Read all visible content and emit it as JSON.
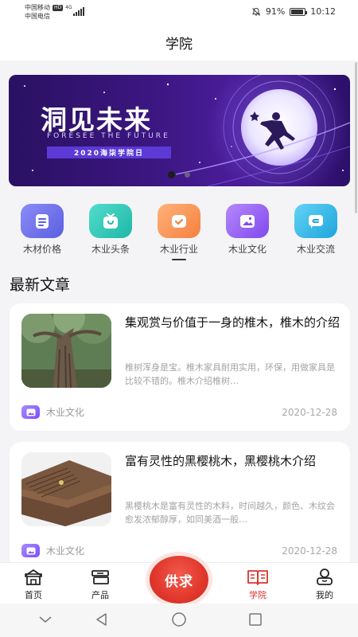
{
  "status_bar": {
    "carrier1": "中国移动",
    "carrier1_badge": "HD",
    "network": "4G",
    "carrier2": "中国电信",
    "battery_percent": "91%",
    "battery_level": 0.91,
    "time": "10:12"
  },
  "header": {
    "title": "学院"
  },
  "banner": {
    "title": "洞见未来",
    "subtitle": "FORESEE THE FUTURE",
    "tag": "2020海柒学院日",
    "colors": {
      "bg_start": "#2a1162",
      "bg_end": "#4a1c98"
    },
    "slides": 2,
    "active_slide": 1
  },
  "categories": [
    {
      "label": "木材价格",
      "icon": "document-icon",
      "color": "#6b6fe8"
    },
    {
      "label": "木业头条",
      "icon": "headline-box-icon",
      "color": "#2cc8b8"
    },
    {
      "label": "木业行业",
      "icon": "check-badge-icon",
      "color": "#f8935a"
    },
    {
      "label": "木业文化",
      "icon": "picture-icon",
      "color": "#9a63f2"
    },
    {
      "label": "木业交流",
      "icon": "chat-icon",
      "color": "#33b9e8"
    }
  ],
  "section": {
    "title": "最新文章"
  },
  "articles": [
    {
      "title": "集观赏与价值于一身的椎木，椎木的介绍",
      "summary": "椎树浑身是宝。椎木家具耐用实用，环保，用做家具是比较不错的。椎木介绍椎树…",
      "category": "木业文化",
      "date": "2020-12-28",
      "thumbnail": "tree-photo"
    },
    {
      "title": "富有灵性的黑樱桃木，黑樱桃木介绍",
      "summary": "黑樱桃木是富有灵性的木料，时间越久，颜色、木纹会愈发浓郁醇厚，如同美酒一般…",
      "category": "木业文化",
      "date": "2020-12-28",
      "thumbnail": "wood-planks-photo"
    }
  ],
  "tabbar": {
    "tabs": [
      {
        "label": "首页",
        "icon": "home-icon"
      },
      {
        "label": "产品",
        "icon": "product-icon"
      },
      {
        "label": "学院",
        "icon": "book-icon"
      },
      {
        "label": "我的",
        "icon": "user-icon"
      }
    ],
    "center_button": "供求",
    "active": "学院",
    "accent_color": "#d8342d"
  }
}
